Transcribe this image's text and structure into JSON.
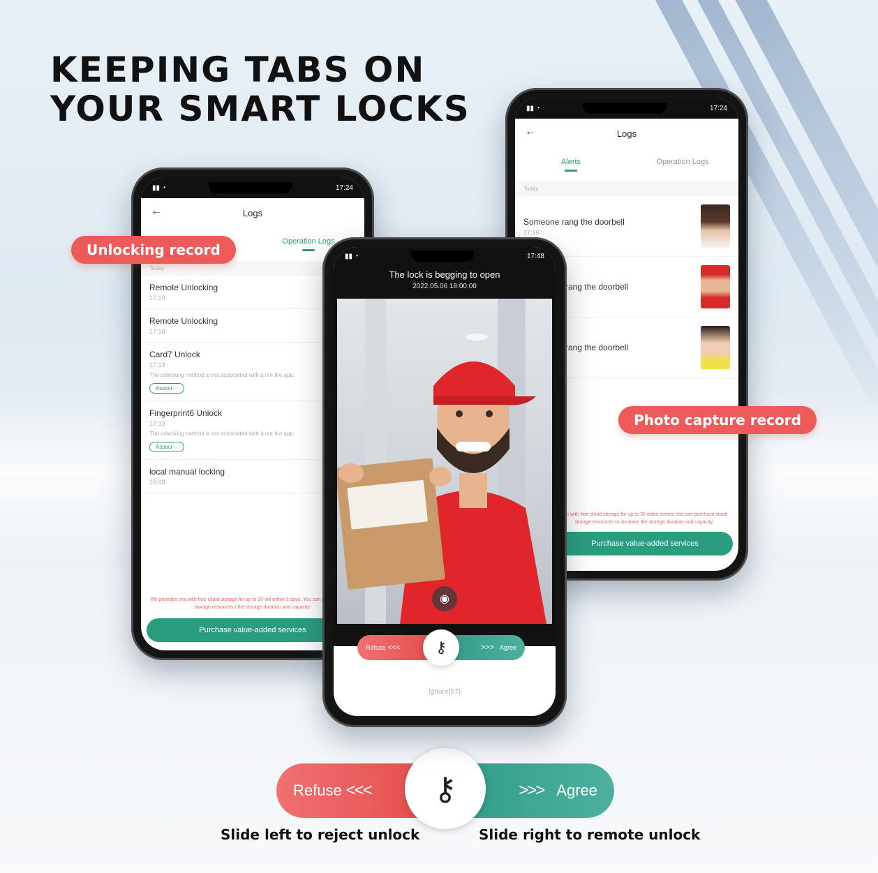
{
  "headline": {
    "line1": "KEEPING TABS ON",
    "line2": "YOUR SMART LOCKS"
  },
  "labels": {
    "unlocking_record": "Unlocking record",
    "photo_capture_record": "Photo capture record"
  },
  "left_phone": {
    "status_time": "17:24",
    "title": "Logs",
    "tab_operation": "Operation Logs",
    "section_today": "Today",
    "items": [
      {
        "title": "Remote Unlocking",
        "time": "17:19"
      },
      {
        "title": "Remote Unlocking",
        "time": "17:18"
      },
      {
        "title": "Card7 Unlock",
        "time": "17:13",
        "note": "The unlocking method is not associated with a me the app.",
        "chip": "Associ···"
      },
      {
        "title": "Fingerprint6 Unlock",
        "time": "17:13",
        "note": "The unlocking method is not associated with a me the app.",
        "chip": "Associ···"
      },
      {
        "title": "local manual locking",
        "time": "16:48"
      }
    ],
    "storage_note": "We provides you with free cloud storage for up to 30 vid within 3 days. You can purchase cloud storage resources t the storage duration and capacity.",
    "purchase_button": "Purchase value-added services"
  },
  "right_phone": {
    "status_time": "17:24",
    "title": "Logs",
    "tab_alerts": "Alerts",
    "tab_operation": "Operation Logs",
    "section_today": "Today",
    "alerts": [
      {
        "title": "Someone rang the doorbell",
        "time": "17:16"
      },
      {
        "title": "e rang the doorbell",
        "time": ""
      },
      {
        "title": "e rang the doorbell",
        "time": ""
      }
    ],
    "storage_note": "you with free cloud storage for up to 30 video events You can purchase cloud storage resources to increase the storage duration and capacity.",
    "purchase_button": "Purchase value-added services"
  },
  "center_phone": {
    "status_time": "17:48",
    "cam_title": "The lock is begging to open",
    "cam_date": "2022.05.06   18:00:00",
    "refuse": "Refuse",
    "agree": "Agree",
    "left_arrows": "<<<",
    "right_arrows": ">>>",
    "ignore": "Ignore(57)"
  },
  "bottom_slider": {
    "refuse": "Refuse",
    "agree": "Agree",
    "left_arrows": "<<<",
    "right_arrows": ">>>"
  },
  "captions": {
    "left": "Slide left to reject unlock",
    "right": "Slide right to remote unlock"
  },
  "colors": {
    "red": "#ee5a5a",
    "green": "#2a9d7e"
  }
}
